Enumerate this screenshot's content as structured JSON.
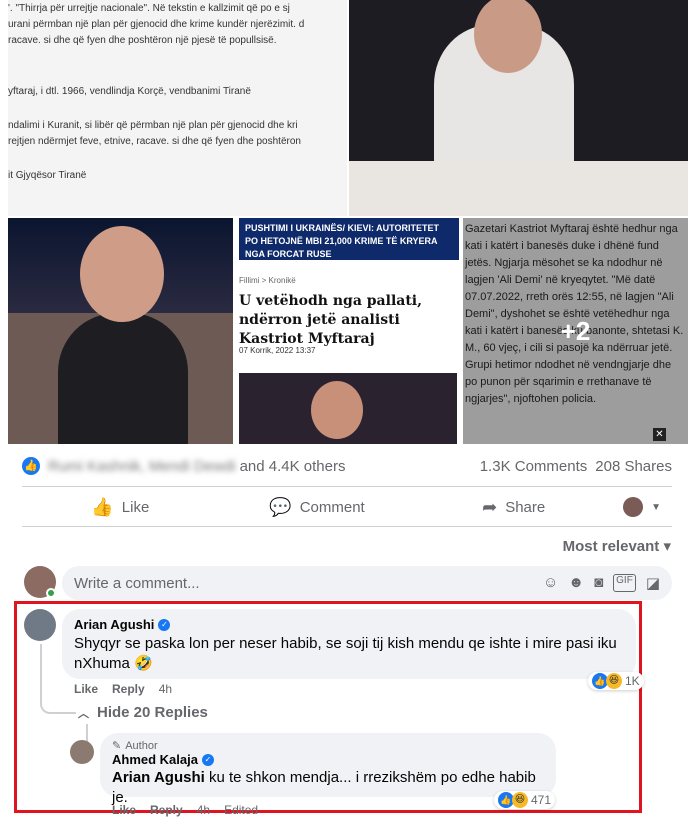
{
  "photos": {
    "tile1_lines": [
      "'. \"Thirrja për urrejtje nacionale\". Në tekstin e kallzimit që po e sj",
      "urani përmban një plan për gjenocid dhe krime kundër njerëzimit. d",
      "racave. si dhe që fyen dhe poshtëron një pjesë të popullsisë.",
      "yftaraj, i dtl. 1966, vendlindja Korçë, vendbanimi Tiranë",
      "ndalimi i Kuranit, si libër që përmban një plan për gjenocid dhe kri",
      "rejtjen ndërmjet feve, etnive, racave. si dhe që fyen dhe poshtëron",
      "it Gjyqësor Tiranë"
    ],
    "news_header": "PUSHTIMI I UKRAINËS/ KIEVI: AUTORITETET PO HETOJNË MBI 21,000 KRIME TË KRYERA NGA FORCAT RUSE",
    "news_breadcrumb": "Fillimi > Kronikë",
    "news_title": "U vetëhodh nga pallati, ndërron jetë analisti Kastriot Myftaraj",
    "news_date": "07 Korrik, 2022 13:37",
    "article_text": "Gazetari Kastriot Myftaraj është hedhur nga kati i katërt i banesës duke i dhënë fund jetës. Ngjarja mësohet se ka ndodhur në lagjen 'Ali Demi' në kryeqytet. \"Më datë 07.07.2022, rreth orës 12:55, në lagjen \"Ali Demi\", dyshohet se është vetëhedhur nga kati i katërt i banesës ku banonte, shtetasi K. M., 60 vjeç, i cili si pasojë ka ndërruar jetë. Grupi hetimor ndodhet në vendngjarje dhe po punon për sqarimin e rrethanave të ngjarjes\", njoftohen policia.",
    "more_count": "+2",
    "close_glyph": "✕"
  },
  "reactions": {
    "names_blurred": "Rumi Kashnik, Mendi Dewdi",
    "others": "and 4.4K others",
    "comments": "1.3K Comments",
    "shares": "208 Shares"
  },
  "actions": {
    "like": "Like",
    "comment": "Comment",
    "share": "Share"
  },
  "sort_label": "Most relevant ▾",
  "write_placeholder": "Write a comment...",
  "comments": [
    {
      "name": "Arian Agushi",
      "text": "Shyqyr se paska lon per neser habib, se soji tij kish mendu qe ishte i mire pasi iku nXhuma 🤣",
      "like_label": "Like",
      "reply_label": "Reply",
      "time": "4h",
      "reaction_count": "1K"
    }
  ],
  "hide_replies": "Hide 20 Replies",
  "reply": {
    "author_tag": "Author",
    "name": "Ahmed Kalaja",
    "mention": "Arian Agushi",
    "text": " ku te shkon mendja... i rrezikshëm po edhe habib je.",
    "like_label": "Like",
    "reply_label": "Reply",
    "time": "4h",
    "edited": "Edited",
    "reaction_count": "471"
  },
  "colors": {
    "facebook_blue": "#1877f2",
    "highlight_red": "#e0141e",
    "bubble_gray": "#f0f2f5"
  }
}
